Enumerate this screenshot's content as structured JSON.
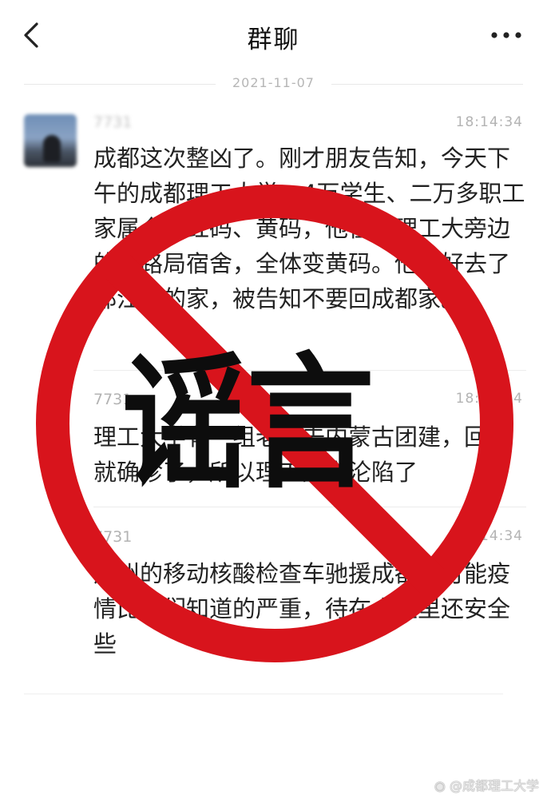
{
  "header": {
    "title": "群聊",
    "back_icon": "chevron-left-icon",
    "more_icon": "more-dots-icon"
  },
  "date_divider": "2021-11-07",
  "messages": [
    {
      "sender": "7731",
      "time": "18:14:34",
      "text": "成都这次整凶了。刚才朋友告知，今天下午的成都理工大学，4万学生、二万多职工家属全部红码、黄码，他住在理工大旁边的铁路局宿舍，全体变黄码。他幸好去了都江堰的家，被告知不要回成都家。"
    },
    {
      "sender": "7731",
      "time": "18:14:34",
      "text": "理工大学有一组老师去内蒙古团建，回来就确诊了，所以理工大学沦陷了"
    },
    {
      "sender": "7731",
      "time": "18:14:34",
      "text": "广州的移动核酸检查车驰援成都，可能疫情比我们知道的严重，待在小区里还安全些"
    }
  ],
  "overlay": {
    "stamp_text": "谣言",
    "stamp_color": "#d8141c"
  },
  "watermark": "@成都理工大学",
  "watermark_icon": "weibo-icon"
}
